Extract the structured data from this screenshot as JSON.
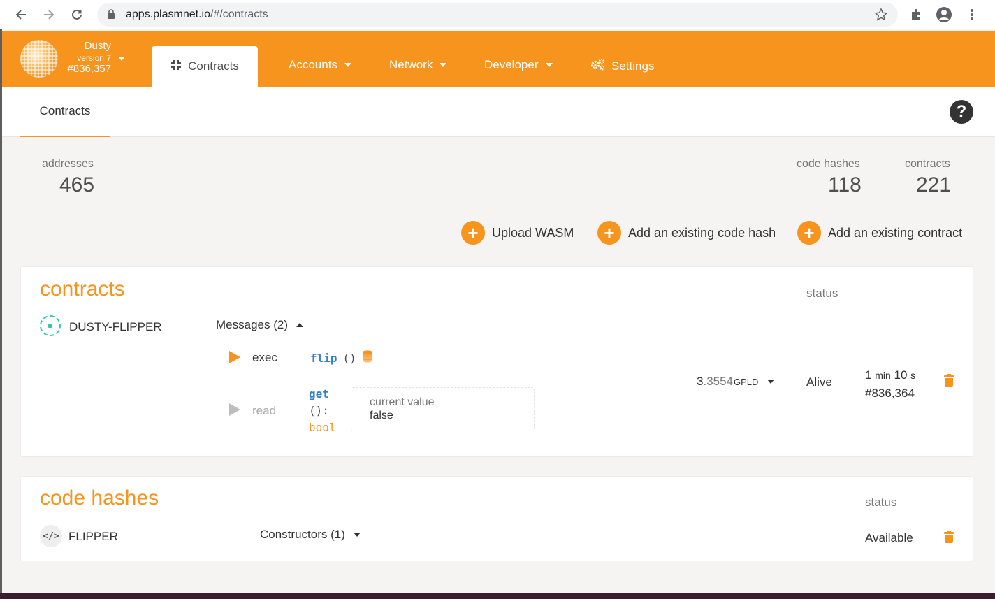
{
  "browser": {
    "url_host": "apps.plasmnet.io",
    "url_path": "/#/contracts"
  },
  "chain": {
    "name": "Dusty",
    "version": "version 7",
    "block": "#836,357"
  },
  "nav": {
    "active_tab": "Contracts",
    "items": [
      "Accounts",
      "Network",
      "Developer",
      "Settings"
    ]
  },
  "subnav": {
    "tab": "Contracts"
  },
  "summary": {
    "addresses_label": "addresses",
    "addresses_value": "465",
    "code_hashes_label": "code hashes",
    "code_hashes_value": "118",
    "contracts_label": "contracts",
    "contracts_value": "221"
  },
  "actions": {
    "upload": "Upload WASM",
    "add_code_hash": "Add an existing code hash",
    "add_contract": "Add an existing contract"
  },
  "contracts_card": {
    "title": "contracts",
    "status_header": "status",
    "contract_name": "DUSTY-FLIPPER",
    "messages_label": "Messages (2)",
    "exec_label": "exec",
    "exec_fn": "flip",
    "exec_args": "()",
    "read_label": "read",
    "read_fn": "get",
    "read_sig": "():",
    "read_ret": "bool",
    "current_value_label": "current value",
    "current_value": "false",
    "balance_int": "3",
    "balance_dec": ".3554",
    "balance_unit": "GPLD",
    "status": "Alive",
    "age_min": "1",
    "age_min_unit": "min",
    "age_sec": "10",
    "age_sec_unit": "s",
    "block": "#836,364"
  },
  "code_card": {
    "title": "code hashes",
    "status_header": "status",
    "code_name": "FLIPPER",
    "constructors_label": "Constructors (1)",
    "status": "Available"
  },
  "colors": {
    "accent": "#f7941d",
    "fn": "#2f7fd2"
  }
}
